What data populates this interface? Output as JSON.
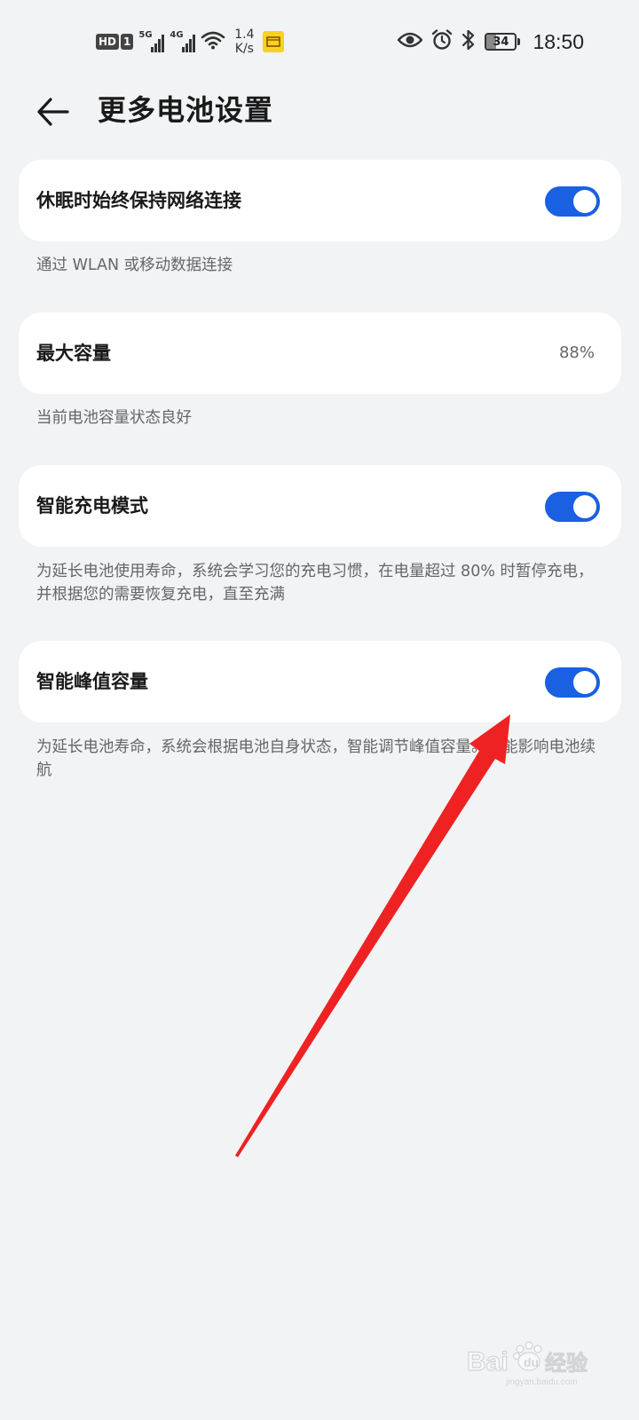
{
  "status_bar": {
    "hd_label": "HD",
    "sim_label": "1",
    "signal1_tag": "5G",
    "signal2_tag": "4G",
    "net_speed_value": "1.4",
    "net_speed_unit": "K/s",
    "time": "18:50",
    "battery_level": "34",
    "battery_fraction": 0.34,
    "icons": [
      "hd-icon",
      "signal-5g-icon",
      "signal-4g-icon",
      "wifi-icon",
      "mini-app-icon",
      "eye-icon",
      "alarm-icon",
      "bluetooth-icon",
      "battery-icon"
    ]
  },
  "header": {
    "back_icon": "arrow-left-icon",
    "title": "更多电池设置"
  },
  "settings": [
    {
      "label": "休眠时始终保持网络连接",
      "control": "toggle",
      "enabled": true,
      "description": "通过 WLAN 或移动数据连接"
    },
    {
      "label": "最大容量",
      "control": "value",
      "value": "88%",
      "description": "当前电池容量状态良好"
    },
    {
      "label": "智能充电模式",
      "control": "toggle",
      "enabled": true,
      "description": "为延长电池使用寿命，系统会学习您的充电习惯，在电量超过 80% 时暂停充电，并根据您的需要恢复充电，直至充满"
    },
    {
      "label": "智能峰值容量",
      "control": "toggle",
      "enabled": true,
      "description": "为延长电池寿命，系统会根据电池自身状态，智能调节峰值容量。可能影响电池续航"
    }
  ],
  "colors": {
    "background": "#f1f3f5",
    "card": "#ffffff",
    "toggle_on": "#1960e3",
    "annotation_arrow": "#ee2222"
  },
  "watermark": {
    "text": "Baidu经验",
    "sub": "jingyan.baidu.com"
  }
}
